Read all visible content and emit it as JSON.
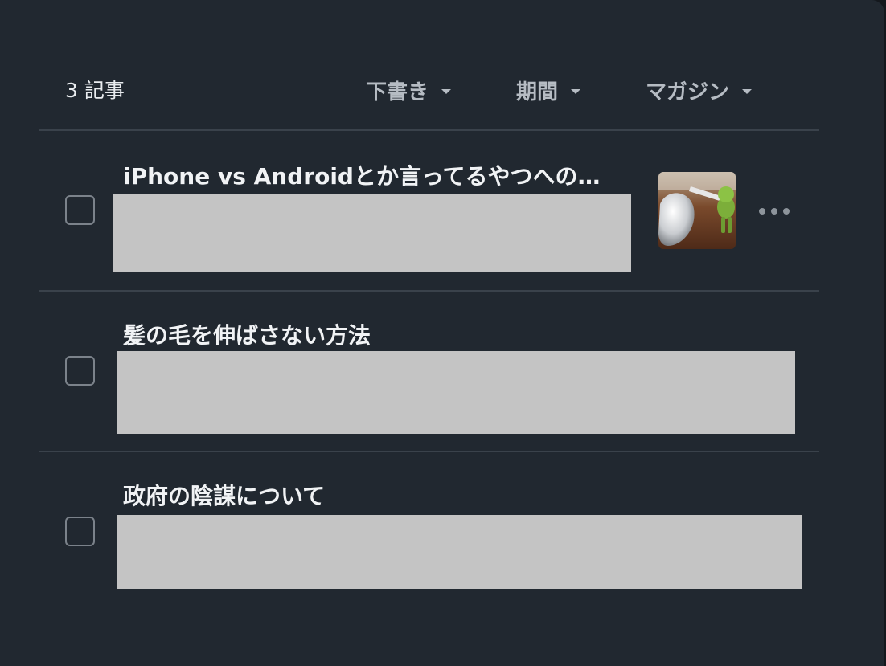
{
  "header": {
    "article_count": "3 記事",
    "filters": [
      {
        "label": "下書き",
        "icon": "chevron-down-icon"
      },
      {
        "label": "期間",
        "icon": "chevron-down-icon"
      },
      {
        "label": "マガジン",
        "icon": "chevron-down-icon"
      }
    ]
  },
  "articles": [
    {
      "title": "iPhone vs Androidとか言ってるやつへの…",
      "thumbnail": "apple-vs-android-image",
      "menu_icon": "more-icon"
    },
    {
      "title": "髪の毛を伸ばさない方法"
    },
    {
      "title": "政府の陰謀について"
    }
  ],
  "colors": {
    "background": "#212830",
    "text": "#f1f3f5",
    "muted": "#b6bcc3",
    "divider": "#3a424b",
    "redacted": "#c4c4c4"
  }
}
